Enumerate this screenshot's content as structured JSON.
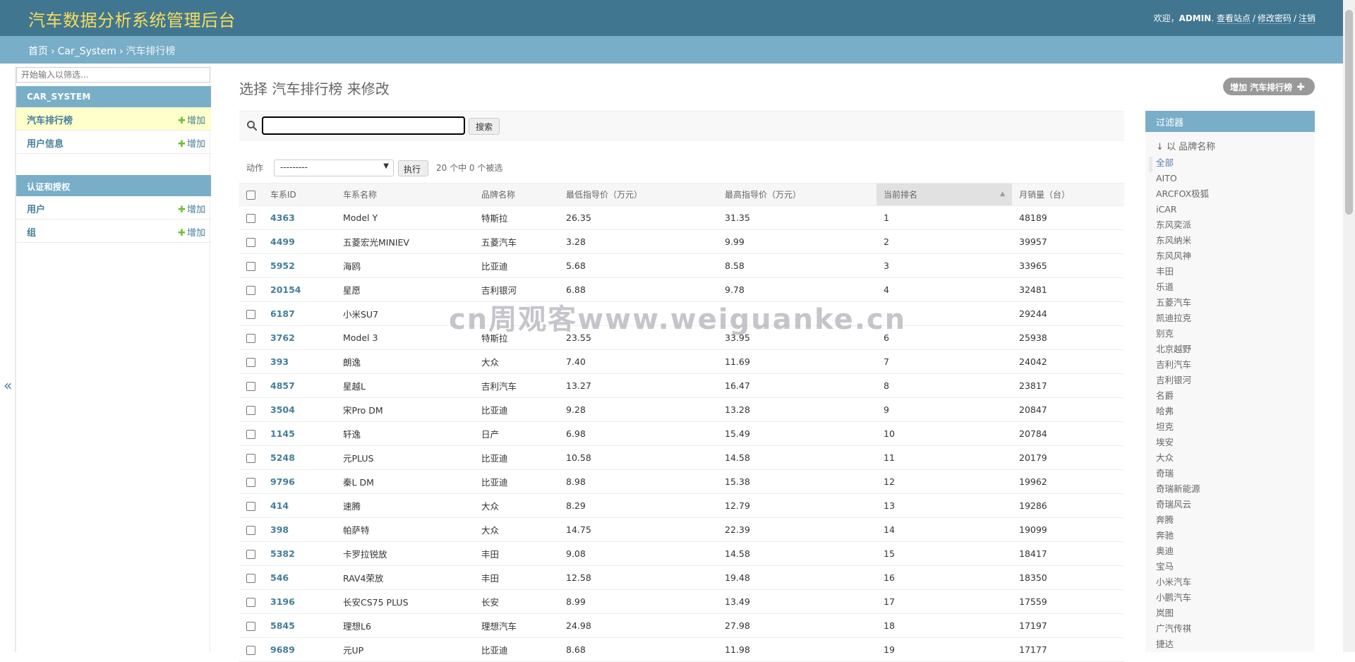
{
  "header": {
    "site_name": "汽车数据分析系统管理后台",
    "welcome": "欢迎，",
    "username": "ADMIN",
    "view_site": "查看站点",
    "change_password": "修改密码",
    "logout": "注销",
    "separator": "/"
  },
  "breadcrumbs": {
    "home": "首页",
    "app": "Car_System",
    "current": "汽车排行榜",
    "separator": "›"
  },
  "sidebar": {
    "filter_placeholder": "开始输入以筛选...",
    "collapse_glyph": "«",
    "modules": [
      {
        "caption": "CAR_SYSTEM",
        "items": [
          {
            "label": "汽车排行榜",
            "add": "增加"
          },
          {
            "label": "用户信息",
            "add": "增加"
          }
        ]
      },
      {
        "caption": "认证和授权",
        "items": [
          {
            "label": "用户",
            "add": "增加"
          },
          {
            "label": "组",
            "add": "增加"
          }
        ]
      }
    ]
  },
  "content": {
    "title": "选择 汽车排行榜 来修改",
    "add_button": "增加 汽车排行榜",
    "search_button": "搜索",
    "action_label": "动作",
    "action_selected": "---------",
    "go_button": "执行",
    "selection_count": "20 个中 0 个被选"
  },
  "table": {
    "columns": [
      "车系ID",
      "车系名称",
      "品牌名称",
      "最低指导价（万元）",
      "最高指导价（万元）",
      "当前排名",
      "月销量（台）"
    ],
    "sorted_column": "当前排名",
    "rows": [
      [
        "4363",
        "Model Y",
        "特斯拉",
        "26.35",
        "31.35",
        "1",
        "48189"
      ],
      [
        "4499",
        "五菱宏光MINIEV",
        "五菱汽车",
        "3.28",
        "9.99",
        "2",
        "39957"
      ],
      [
        "5952",
        "海鸥",
        "比亚迪",
        "5.68",
        "8.58",
        "3",
        "33965"
      ],
      [
        "20154",
        "星愿",
        "吉利银河",
        "6.88",
        "9.78",
        "4",
        "32481"
      ],
      [
        "6187",
        "小米SU7",
        "",
        "",
        "",
        "",
        "29244"
      ],
      [
        "3762",
        "Model 3",
        "特斯拉",
        "23.55",
        "33.95",
        "6",
        "25938"
      ],
      [
        "393",
        "朗逸",
        "大众",
        "7.40",
        "11.69",
        "7",
        "24042"
      ],
      [
        "4857",
        "星越L",
        "吉利汽车",
        "13.27",
        "16.47",
        "8",
        "23817"
      ],
      [
        "3504",
        "宋Pro DM",
        "比亚迪",
        "9.28",
        "13.28",
        "9",
        "20847"
      ],
      [
        "1145",
        "轩逸",
        "日产",
        "6.98",
        "15.49",
        "10",
        "20784"
      ],
      [
        "5248",
        "元PLUS",
        "比亚迪",
        "10.58",
        "14.58",
        "11",
        "20179"
      ],
      [
        "9796",
        "秦L DM",
        "比亚迪",
        "8.98",
        "15.38",
        "12",
        "19962"
      ],
      [
        "414",
        "速腾",
        "大众",
        "8.29",
        "12.79",
        "13",
        "19286"
      ],
      [
        "398",
        "帕萨特",
        "大众",
        "14.75",
        "22.39",
        "14",
        "19099"
      ],
      [
        "5382",
        "卡罗拉锐放",
        "丰田",
        "9.08",
        "14.58",
        "15",
        "18417"
      ],
      [
        "546",
        "RAV4荣放",
        "丰田",
        "12.58",
        "19.48",
        "16",
        "18350"
      ],
      [
        "3196",
        "长安CS75 PLUS",
        "长安",
        "8.99",
        "13.49",
        "17",
        "17559"
      ],
      [
        "5845",
        "理想L6",
        "理想汽车",
        "24.98",
        "27.98",
        "18",
        "17197"
      ],
      [
        "9689",
        "元UP",
        "比亚迪",
        "8.68",
        "11.98",
        "19",
        "17177"
      ]
    ]
  },
  "filter": {
    "title": "过滤器",
    "heading": "↓ 以 品牌名称",
    "options": [
      "全部",
      "AITO",
      "ARCFOX极狐",
      "iCAR",
      "东风奕派",
      "东风纳米",
      "东风风神",
      "丰田",
      "乐道",
      "五菱汽车",
      "凯迪拉克",
      "别克",
      "北京越野",
      "吉利汽车",
      "吉利银河",
      "名爵",
      "哈弗",
      "坦克",
      "埃安",
      "大众",
      "奇瑞",
      "奇瑞新能源",
      "奇瑞风云",
      "奔腾",
      "奔驰",
      "奥迪",
      "宝马",
      "小米汽车",
      "小鹏汽车",
      "岚图",
      "广汽传祺",
      "捷达"
    ]
  },
  "watermark": "cn周观客www.weiguanke.cn"
}
